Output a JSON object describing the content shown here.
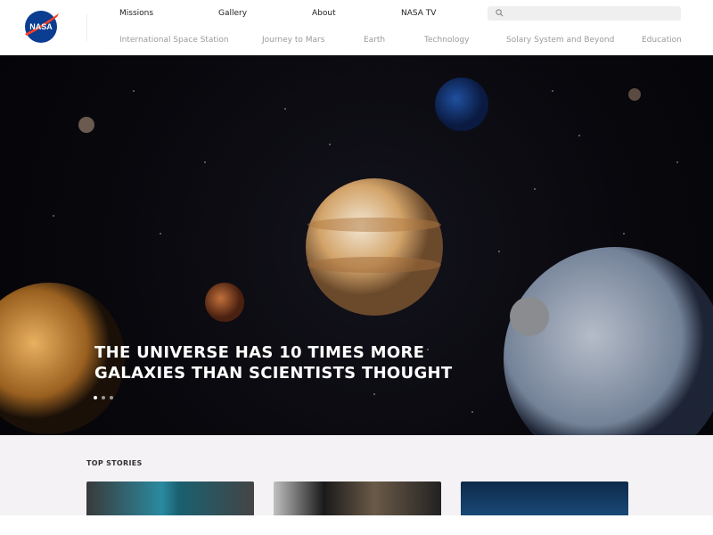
{
  "header": {
    "logo_text": "NASA",
    "primary_nav": [
      "Missions",
      "Gallery",
      "About",
      "NASA TV"
    ],
    "secondary_nav": [
      "International Space Station",
      "Journey to Mars",
      "Earth",
      "Technology",
      "Solary System and Beyond",
      "Education"
    ],
    "search": {
      "placeholder": "",
      "icon": "search-icon"
    }
  },
  "hero": {
    "title_line1": "THE UNIVERSE HAS 10 TIMES MORE",
    "title_line2": "GALAXIES THAN SCIENTISTS THOUGHT",
    "slides": 3,
    "active_slide": 1
  },
  "top_stories": {
    "title": "TOP STORIES",
    "cards": 3
  },
  "colors": {
    "nasa_blue": "#0b3d91",
    "nasa_red": "#fc3d21",
    "stories_bg": "#f4f2f5"
  }
}
